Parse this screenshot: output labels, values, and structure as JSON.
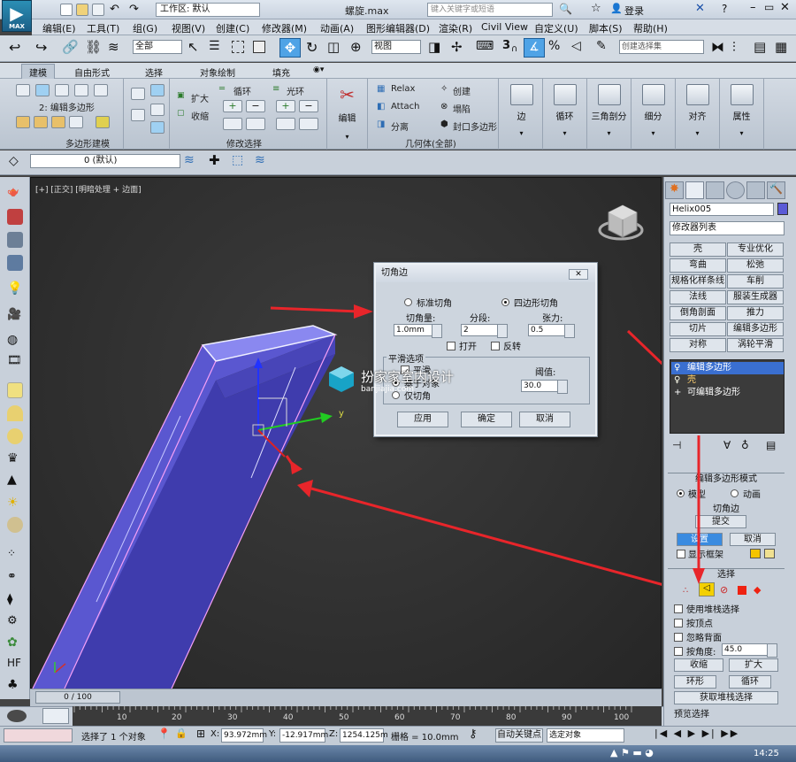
{
  "app": {
    "logo_text": "MAX",
    "workspace": "工作区: 默认",
    "file_name": "螺旋.max",
    "search_placeholder": "键入关键字或短语",
    "login": "登录"
  },
  "menu": [
    "编辑(E)",
    "工具(T)",
    "组(G)",
    "视图(V)",
    "创建(C)",
    "修改器(M)",
    "动画(A)",
    "图形编辑器(D)",
    "渲染(R)",
    "Civil View",
    "自定义(U)",
    "脚本(S)",
    "帮助(H)"
  ],
  "toolbar": {
    "selection_filter": "全部",
    "ref_coord": "视图",
    "named_selection": "创建选择集",
    "snap_3": "3",
    "snap_angle": "%"
  },
  "ribbon": {
    "tabs": [
      "建模",
      "自由形式",
      "选择",
      "对象绘制",
      "填充"
    ],
    "active_tab": "建模",
    "poly_modeling": {
      "mode_label": "2: 编辑多边形",
      "section": "多边形建模"
    },
    "modify_selection": {
      "grow": "扩大",
      "shrink": "收缩",
      "loop": "循环",
      "ring": "光环",
      "section": "修改选择"
    },
    "edit": {
      "label": "编辑"
    },
    "geometry": {
      "relax": "Relax",
      "attach": "Attach",
      "separate": "分离",
      "create": "创建",
      "cap": "塌陷",
      "cap_poly": "封口多边形",
      "section": "几何体(全部)"
    },
    "big_buttons": [
      "边",
      "循环",
      "三角剖分",
      "细分",
      "对齐",
      "属性"
    ]
  },
  "layer": {
    "current": "0 (默认)"
  },
  "viewport": {
    "label": "[+] [正交] [明暗处理 + 边面]",
    "axis_y": "y"
  },
  "command_panel": {
    "object_name": "Helix005",
    "object_color": "#5b5bd6",
    "modifier_list": "修改器列表",
    "modifier_buttons": [
      "壳",
      "专业优化",
      "弯曲",
      "松弛",
      "规格化样条线",
      "车削",
      "法线",
      "服装生成器",
      "倒角剖面",
      "推力",
      "切片",
      "编辑多边形",
      "对称",
      "涡轮平滑"
    ],
    "stack": [
      {
        "label": "编辑多边形",
        "selected": true
      },
      {
        "label": "壳",
        "selected": false
      },
      {
        "label": "可编辑多边形",
        "selected": false
      }
    ],
    "edit_poly_mode": {
      "title": "编辑多边形模式",
      "model": "模型",
      "animate": "动画",
      "current_op": "切角边",
      "commit": "提交",
      "settings": "设置",
      "cancel": "取消",
      "show_cage": "显示框架"
    },
    "selection": {
      "title": "选择",
      "use_stack": "使用堆栈选择",
      "by_vertex": "按顶点",
      "ignore_backface": "忽略背面",
      "by_angle": "按角度:",
      "angle_value": "45.0",
      "shrink": "收缩",
      "grow": "扩大",
      "ring": "环形",
      "loop": "循环",
      "get_stack": "获取堆栈选择",
      "preview": "预览选择"
    }
  },
  "dialog": {
    "title": "切角边",
    "standard": "标准切角",
    "quad": "四边形切角",
    "amount_label": "切角量:",
    "segments_label": "分段:",
    "tension_label": "张力:",
    "amount": "1.0mm",
    "segments": "2",
    "tension": "0.5",
    "open": "打开",
    "invert": "反转",
    "smooth_group": "平滑选项",
    "smooth": "平滑",
    "smooth_sub1": "基于对象",
    "smooth_sub2": "仅切角",
    "threshold_label": "阈值:",
    "threshold": "30.0",
    "apply": "应用",
    "ok": "确定",
    "cancel": "取消"
  },
  "watermark": {
    "title": "扮家家室内设计",
    "url": "banjiajia.com"
  },
  "timeline": {
    "frame": "0 / 100",
    "ticks": [
      "10",
      "20",
      "30",
      "40",
      "50",
      "60",
      "70",
      "80",
      "90",
      "100"
    ]
  },
  "status": {
    "selected": "选择了 1 个对象",
    "x_label": "X:",
    "x": "93.972mm",
    "y_label": "Y:",
    "y": "-12.917mm",
    "z_label": "Z:",
    "z": "1254.125m",
    "grid": "栅格 = 10.0mm",
    "auto_key": "自动关键点",
    "selected_obj": "选定对象",
    "time": "14:25"
  }
}
